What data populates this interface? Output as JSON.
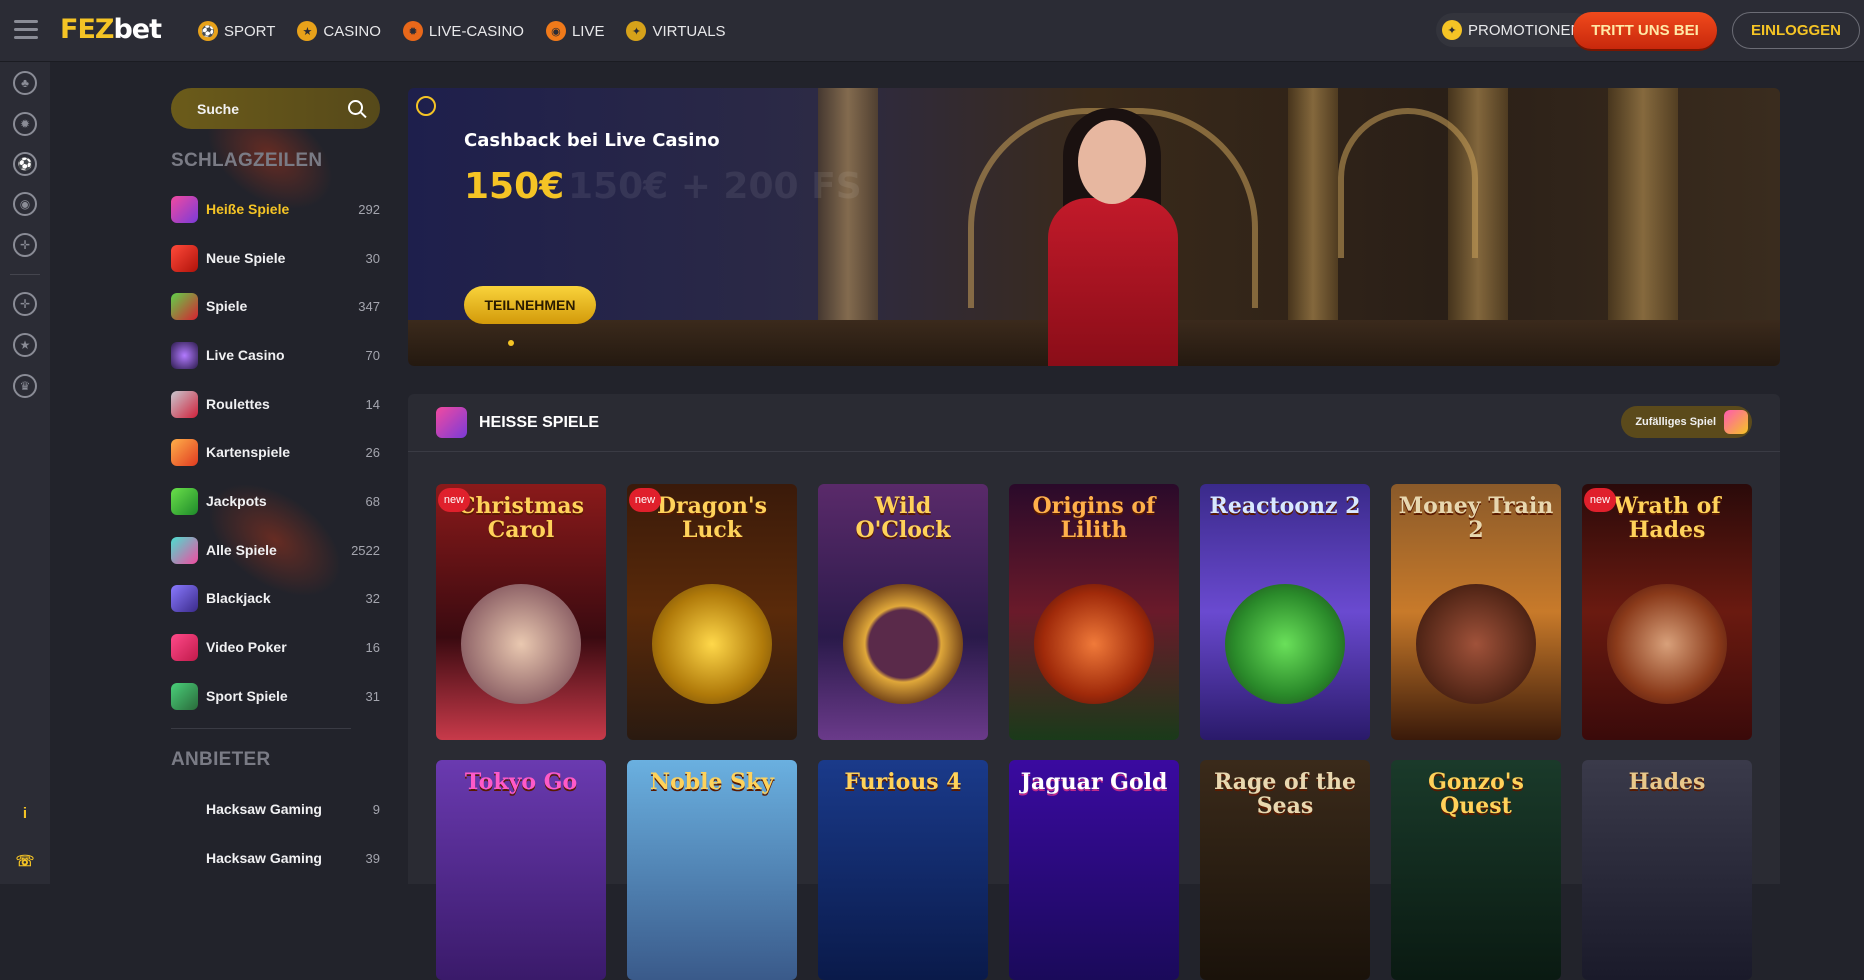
{
  "header": {
    "logo_part1": "FEZ",
    "logo_part2": "bet",
    "nav": [
      {
        "label": "SPORT",
        "icon": "soccer-ball-icon"
      },
      {
        "label": "CASINO",
        "icon": "casino-chip-icon"
      },
      {
        "label": "LIVE-CASINO",
        "icon": "roulette-icon"
      },
      {
        "label": "LIVE",
        "icon": "live-signal-icon"
      },
      {
        "label": "VIRTUALS",
        "icon": "virtual-icon"
      }
    ],
    "promotions_label": "PROMOTIONEN",
    "join_label": "TRITT UNS BEI",
    "login_label": "EINLOGGEN"
  },
  "colors": {
    "accent": "#f5c425",
    "cta": "#e03a14",
    "background": "#22232b",
    "panel": "#2a2b33"
  },
  "search": {
    "placeholder": "Suche"
  },
  "sidebar": {
    "headlines_title": "SCHLAGZEILEN",
    "categories": [
      {
        "label": "Heiße Spiele",
        "count": "292",
        "active": true
      },
      {
        "label": "Neue Spiele",
        "count": "30"
      },
      {
        "label": "Spiele",
        "count": "347"
      },
      {
        "label": "Live Casino",
        "count": "70"
      },
      {
        "label": "Roulettes",
        "count": "14"
      },
      {
        "label": "Kartenspiele",
        "count": "26"
      },
      {
        "label": "Jackpots",
        "count": "68"
      },
      {
        "label": "Alle Spiele",
        "count": "2522"
      },
      {
        "label": "Blackjack",
        "count": "32"
      },
      {
        "label": "Video Poker",
        "count": "16"
      },
      {
        "label": "Sport Spiele",
        "count": "31"
      }
    ],
    "providers_title": "ANBIETER",
    "providers": [
      {
        "label": "Hacksaw Gaming",
        "count": "9"
      },
      {
        "label": "Hacksaw Gaming",
        "count": "39"
      }
    ]
  },
  "banner": {
    "title": "Cashback bei Live Casino",
    "amount": "150€",
    "ghost_text": "150€ + 200 FS",
    "button": "TEILNEHMEN"
  },
  "games": {
    "title": "HEISSE SPIELE",
    "random_label": "Zufälliges Spiel",
    "new_badge": "new",
    "row1": [
      {
        "name": "Christmas Carol",
        "new": true
      },
      {
        "name": "Dragon's Luck",
        "new": true
      },
      {
        "name": "Wild O'Clock",
        "new": false
      },
      {
        "name": "Origins of Lilith",
        "new": false
      },
      {
        "name": "Reactoonz 2",
        "new": false
      },
      {
        "name": "Money Train 2",
        "new": false
      },
      {
        "name": "Wrath of Hades",
        "new": true
      }
    ],
    "row2": [
      {
        "name": "Tokyo Go"
      },
      {
        "name": "Noble Sky"
      },
      {
        "name": "Furious 4"
      },
      {
        "name": "Jaguar Gold"
      },
      {
        "name": "Rage of the Seas"
      },
      {
        "name": "Gonzo's Quest"
      },
      {
        "name": "Hades"
      }
    ]
  }
}
